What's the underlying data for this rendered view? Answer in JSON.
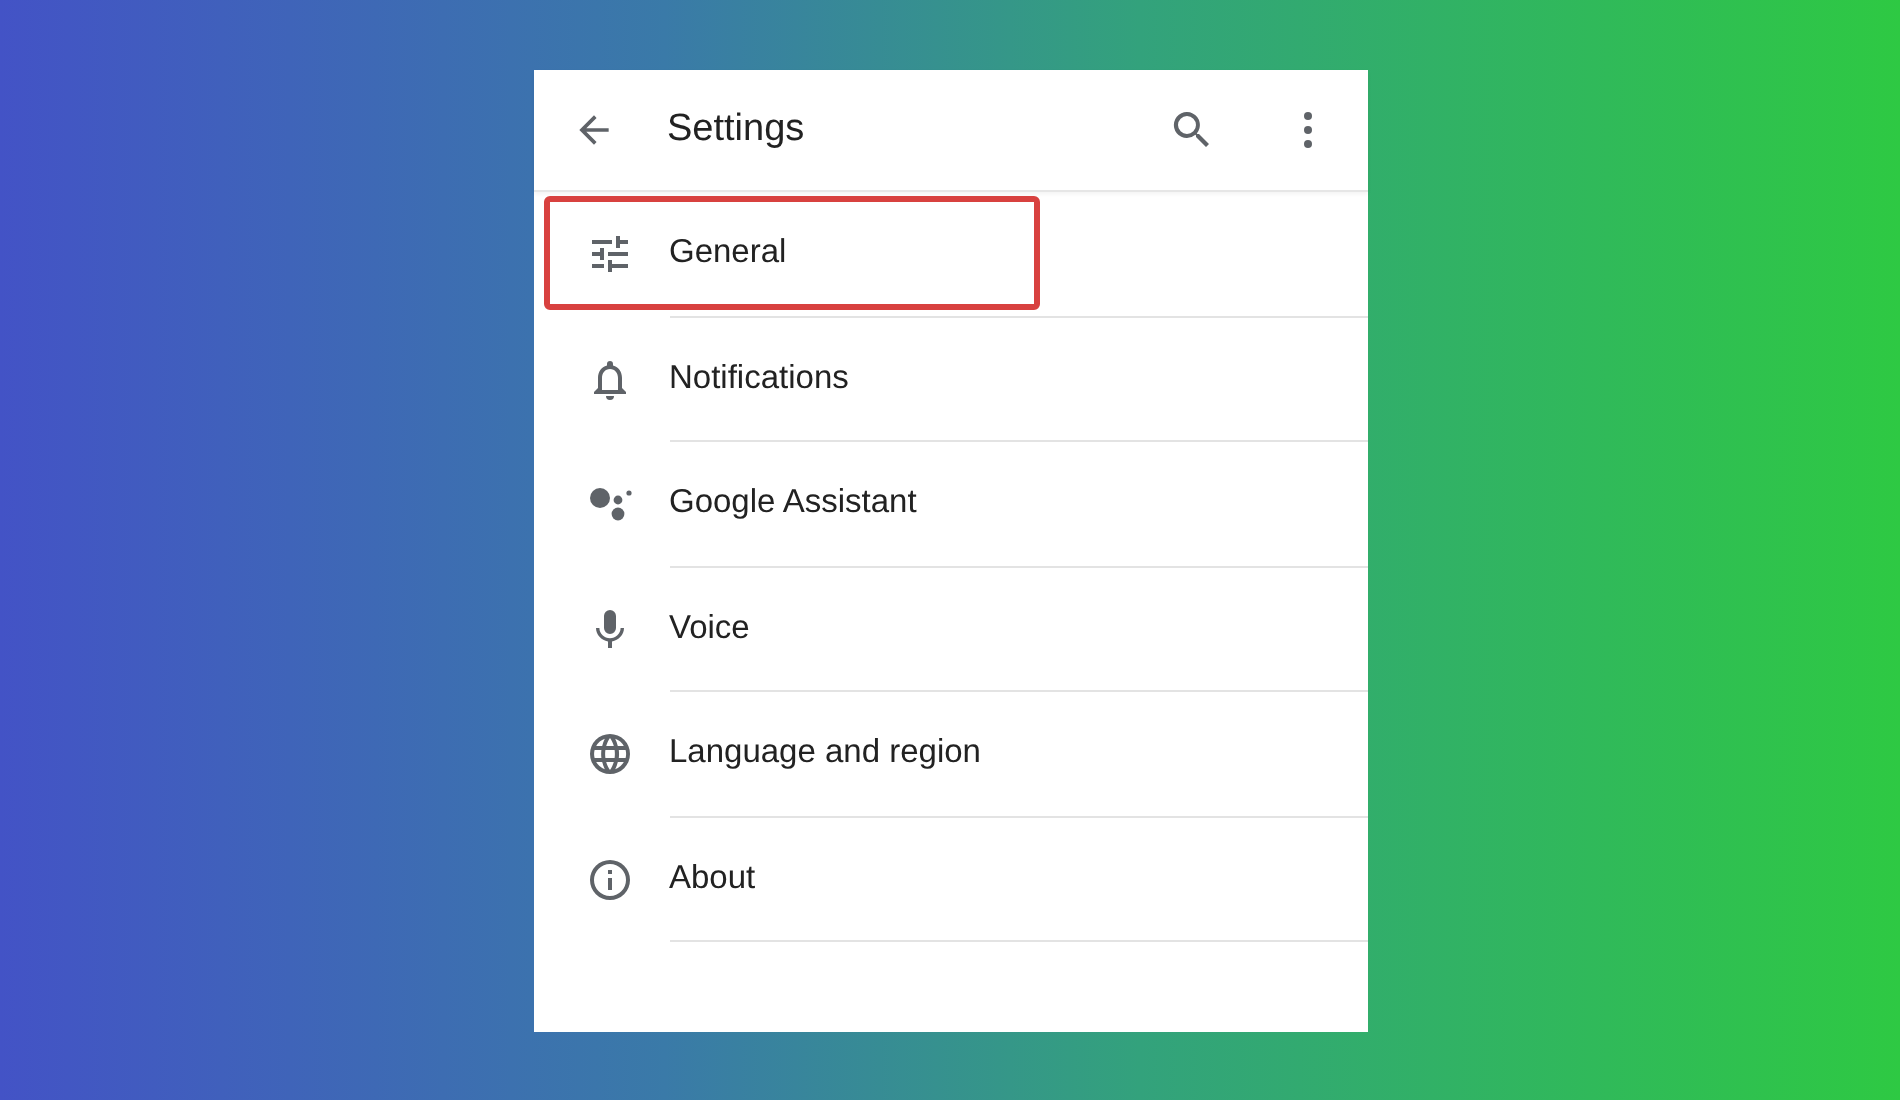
{
  "app_bar": {
    "title": "Settings"
  },
  "items": [
    {
      "label": "General",
      "highlighted": true
    },
    {
      "label": "Notifications",
      "highlighted": false
    },
    {
      "label": "Google Assistant",
      "highlighted": false
    },
    {
      "label": "Voice",
      "highlighted": false
    },
    {
      "label": "Language and region",
      "highlighted": false
    },
    {
      "label": "About",
      "highlighted": false
    }
  ]
}
